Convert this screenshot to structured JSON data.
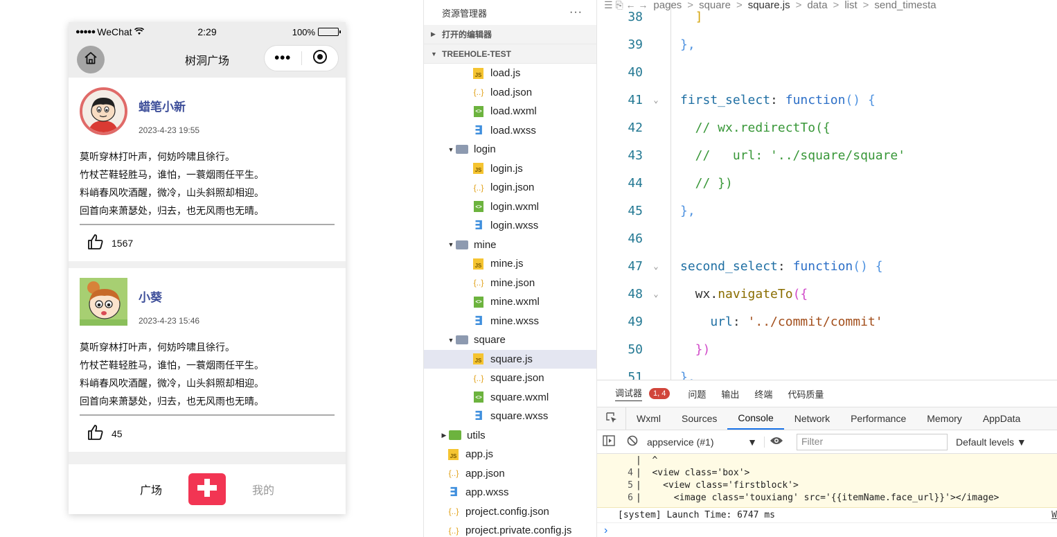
{
  "phone": {
    "status": {
      "signal": "●●●●●",
      "carrier": "WeChat",
      "time": "2:29",
      "battery": "100%",
      "battery_level": 1.0
    },
    "nav": {
      "title": "树洞广场",
      "more": "•••"
    },
    "posts": [
      {
        "username": "蜡笔小新",
        "time": "2023-4-23 19:55",
        "lines": [
          "莫听穿林打叶声，何妨吟啸且徐行。",
          "竹杖芒鞋轻胜马，谁怕，一蓑烟雨任平生。",
          "料峭春风吹酒醒，微冷，山头斜照却相迎。",
          "回首向来萧瑟处，归去，也无风雨也无晴。"
        ],
        "likes": "1567"
      },
      {
        "username": "小葵",
        "time": "2023-4-23 15:46",
        "lines": [
          "莫听穿林打叶声，何妨吟啸且徐行。",
          "竹杖芒鞋轻胜马，谁怕，一蓑烟雨任平生。",
          "料峭春风吹酒醒，微冷，山头斜照却相迎。",
          "回首向来萧瑟处，归去，也无风雨也无晴。"
        ],
        "likes": "45"
      }
    ],
    "tabbar": {
      "square": "广场",
      "mine": "我的"
    },
    "colors": {
      "accent": "#f23553",
      "username": "#3e4f9a"
    }
  },
  "explorer": {
    "title": "资源管理器",
    "more": "···",
    "open_editors": "打开的编辑器",
    "project": "TREEHOLE-TEST",
    "tree": [
      {
        "name": "load.js",
        "type": "js",
        "depth": 2
      },
      {
        "name": "load.json",
        "type": "json",
        "depth": 2
      },
      {
        "name": "load.wxml",
        "type": "wxml",
        "depth": 2
      },
      {
        "name": "load.wxss",
        "type": "wxss",
        "depth": 2
      },
      {
        "name": "login",
        "type": "folder",
        "depth": 1,
        "open": true
      },
      {
        "name": "login.js",
        "type": "js",
        "depth": 2
      },
      {
        "name": "login.json",
        "type": "json",
        "depth": 2
      },
      {
        "name": "login.wxml",
        "type": "wxml",
        "depth": 2
      },
      {
        "name": "login.wxss",
        "type": "wxss",
        "depth": 2
      },
      {
        "name": "mine",
        "type": "folder",
        "depth": 1,
        "open": true
      },
      {
        "name": "mine.js",
        "type": "js",
        "depth": 2
      },
      {
        "name": "mine.json",
        "type": "json",
        "depth": 2
      },
      {
        "name": "mine.wxml",
        "type": "wxml",
        "depth": 2
      },
      {
        "name": "mine.wxss",
        "type": "wxss",
        "depth": 2
      },
      {
        "name": "square",
        "type": "folder",
        "depth": 1,
        "open": true
      },
      {
        "name": "square.js",
        "type": "js",
        "depth": 2,
        "selected": true
      },
      {
        "name": "square.json",
        "type": "json",
        "depth": 2
      },
      {
        "name": "square.wxml",
        "type": "wxml",
        "depth": 2
      },
      {
        "name": "square.wxss",
        "type": "wxss",
        "depth": 2
      },
      {
        "name": "utils",
        "type": "folder-green",
        "depth": 0,
        "open": false
      },
      {
        "name": "app.js",
        "type": "js",
        "depth": 0
      },
      {
        "name": "app.json",
        "type": "json",
        "depth": 0
      },
      {
        "name": "app.wxss",
        "type": "wxss",
        "depth": 0
      },
      {
        "name": "project.config.json",
        "type": "json",
        "depth": 0
      },
      {
        "name": "project.private.config.js",
        "type": "json",
        "depth": 0
      }
    ]
  },
  "editor": {
    "breadcrumb": [
      "pages",
      "square",
      "square.js",
      "data",
      "list",
      "send_timesta"
    ],
    "lines": [
      {
        "no": "38",
        "tokens": [
          {
            "t": "  ]",
            "c": "c-br3"
          }
        ]
      },
      {
        "no": "39",
        "tokens": [
          {
            "t": "},",
            "c": "c-br1"
          }
        ]
      },
      {
        "no": "40",
        "tokens": []
      },
      {
        "no": "41",
        "fold": true,
        "tokens": [
          {
            "t": "first_select",
            "c": "c-prop"
          },
          {
            "t": ": ",
            "c": "c-pun"
          },
          {
            "t": "function",
            "c": "c-kw"
          },
          {
            "t": "() {",
            "c": "c-br1"
          }
        ]
      },
      {
        "no": "42",
        "tokens": [
          {
            "t": "  // wx.redirectTo({",
            "c": "c-com"
          }
        ]
      },
      {
        "no": "43",
        "tokens": [
          {
            "t": "  //   url: '../square/square'",
            "c": "c-com"
          }
        ]
      },
      {
        "no": "44",
        "tokens": [
          {
            "t": "  // })",
            "c": "c-com"
          }
        ]
      },
      {
        "no": "45",
        "tokens": [
          {
            "t": "},",
            "c": "c-br1"
          }
        ]
      },
      {
        "no": "46",
        "tokens": []
      },
      {
        "no": "47",
        "fold": true,
        "tokens": [
          {
            "t": "second_select",
            "c": "c-prop"
          },
          {
            "t": ": ",
            "c": "c-pun"
          },
          {
            "t": "function",
            "c": "c-kw"
          },
          {
            "t": "() {",
            "c": "c-br1"
          }
        ]
      },
      {
        "no": "48",
        "fold": true,
        "tokens": [
          {
            "t": "  wx.",
            "c": "c-pun"
          },
          {
            "t": "navigateTo",
            "c": "c-fn"
          },
          {
            "t": "({",
            "c": "c-br2"
          }
        ]
      },
      {
        "no": "49",
        "tokens": [
          {
            "t": "    url",
            "c": "c-prop"
          },
          {
            "t": ": ",
            "c": "c-pun"
          },
          {
            "t": "'../commit/commit'",
            "c": "c-str"
          }
        ]
      },
      {
        "no": "50",
        "tokens": [
          {
            "t": "  })",
            "c": "c-br2"
          }
        ]
      },
      {
        "no": "51",
        "tokens": [
          {
            "t": "},",
            "c": "c-br1"
          }
        ]
      }
    ]
  },
  "devtools": {
    "top_tabs": [
      "调试器",
      "问题",
      "输出",
      "终端",
      "代码质量"
    ],
    "badge": "1, 4",
    "tabs": [
      "Wxml",
      "Sources",
      "Console",
      "Network",
      "Performance",
      "Memory",
      "AppData"
    ],
    "active_tab": "Console",
    "context": "appservice (#1)",
    "filter_placeholder": "Filter",
    "levels": "Default levels ▼",
    "console_lines": [
      {
        "no": "",
        "text": "|  ^"
      },
      {
        "no": "4",
        "text": "|  <view class='box'>"
      },
      {
        "no": "5",
        "text": "|    <view class='firstblock'>"
      },
      {
        "no": "6",
        "text": "|      <image class='touxiang' src='{{itemName.face_url}}'></image>"
      }
    ],
    "system_line": "[system] Launch Time: 6747 ms",
    "source_link": "W",
    "prompt": "›"
  }
}
